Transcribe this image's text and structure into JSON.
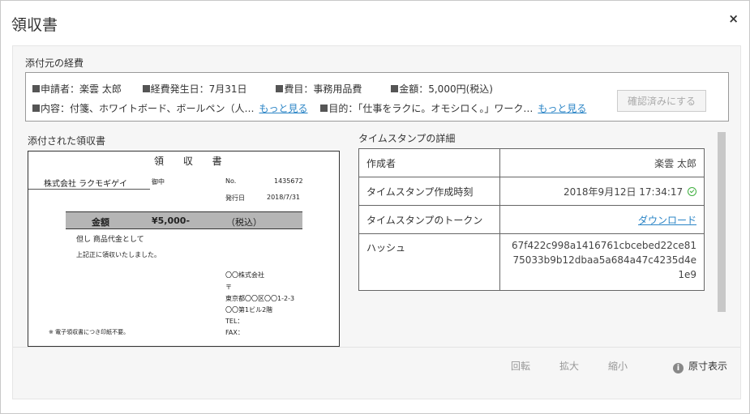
{
  "modal": {
    "title": "領収書",
    "close_glyph": "×"
  },
  "source": {
    "title": "添付元の経費",
    "applicant": "申請者：楽雲 太郎",
    "expense_date": "経費発生日：7月31日",
    "category": "費目：事務用品費",
    "amount": "金額：5,000円(税込)",
    "content": "内容：付箋、ホワイトボード、ボールペン（人…",
    "purpose": "目的：「仕事をラクに。オモシロく。」ワーク…",
    "more_label": "もっと見る",
    "confirm_button": "確認済みにする"
  },
  "receipt": {
    "section_title": "添付された領収書",
    "doc_title": "領 収 書",
    "company": "株式会社 ラクモギゲイ",
    "honorific": "御中",
    "no_label": "No.",
    "no_value": "1435672",
    "issued_label": "発行日",
    "issued_value": "2018/7/31",
    "amount_label": "金額",
    "amount_value": "¥5,000-",
    "tax_note": "（税込）",
    "purpose_line": "但し 商品代金として",
    "received_line": "上記正に領収いたしました。",
    "issuer_lines": [
      "〇〇株式会社",
      "〒",
      "東京都〇〇区〇〇1-2-3",
      "〇〇第1ビル2階",
      "TEL：",
      "FAX："
    ],
    "stamp_note": "※ 電子領収書につき印紙不要。"
  },
  "timestamp": {
    "section_title": "タイムスタンプの詳細",
    "rows": [
      {
        "key": "作成者",
        "value": "楽雲 太郎"
      },
      {
        "key": "タイムスタンプ作成時刻",
        "value": "2018年9月12日 17:34:17"
      },
      {
        "key": "タイムスタンプのトークン",
        "value": "ダウンロード"
      },
      {
        "key": "ハッシュ",
        "value_lines": [
          "67f422c998a1416761cbcebed22ce81",
          "75033b9b12dbaa5a684a47c4235d4e",
          "1e9"
        ]
      }
    ],
    "verified_color": "#3fae3f"
  },
  "footer": {
    "rotate": "回転",
    "zoom_in": "拡大",
    "zoom_out": "縮小",
    "original_size": "原寸表示",
    "info_glyph": "i"
  },
  "colors": {
    "link": "#2a84c6",
    "disabled": "#aaaaaa"
  }
}
